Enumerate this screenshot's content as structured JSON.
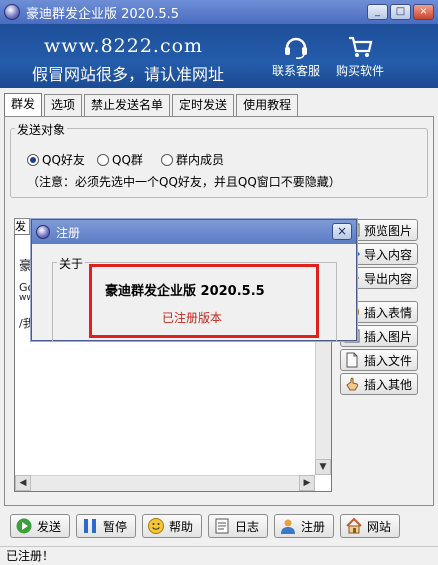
{
  "window": {
    "title": "豪迪群发企业版 2020.5.5",
    "buttons": [
      "_",
      "□",
      "×"
    ]
  },
  "banner": {
    "site": "www.8222.com",
    "slogan": "假冒网站很多，请认准网址",
    "support": "联系客服",
    "buy": "购买软件"
  },
  "tabs": [
    "群发",
    "选项",
    "禁止发送名单",
    "定时发送",
    "使用教程"
  ],
  "send_target": {
    "legend": "发送对象",
    "options": [
      "QQ好友",
      "QQ群",
      "群内成员"
    ],
    "selected": "QQ好友",
    "note": "（注意：必须先选中一个QQ好友，并且QQ窗口不要隐藏）"
  },
  "editor": {
    "tab": "发",
    "lines": [
      "豪",
      "Go",
      "ww",
      "/我"
    ]
  },
  "side_buttons": [
    "预览图片",
    "导入内容",
    "导出内容",
    "插入表情",
    "插入图片",
    "插入文件",
    "插入其他"
  ],
  "bottom_buttons": [
    "发送",
    "暂停",
    "帮助",
    "日志",
    "注册",
    "网站"
  ],
  "status": "已注册！",
  "dialog": {
    "title": "注册",
    "group": "关于",
    "product": "豪迪群发企业版  2020.5.5",
    "state": "已注册版本",
    "close": "×"
  }
}
